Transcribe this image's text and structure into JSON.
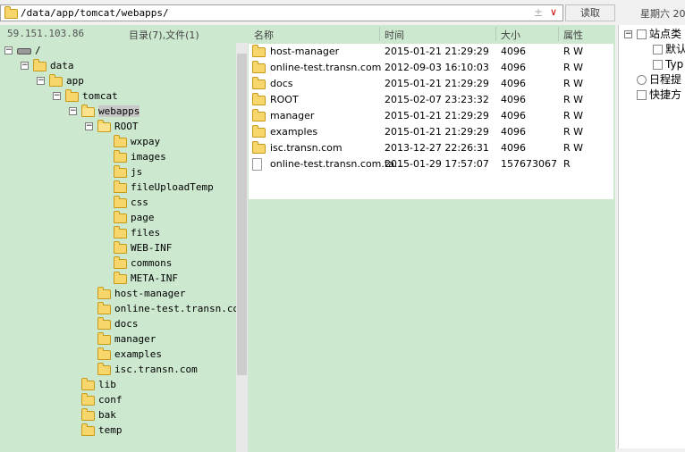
{
  "toolbar": {
    "path": "/data/app/tomcat/webapps/",
    "plus": "±",
    "dropdown": "∨",
    "read_label": "读取",
    "date_text": "星期六 20"
  },
  "left": {
    "ip": "59.151.103.86",
    "counts": "目录(7),文件(1)",
    "tree": [
      {
        "label": "/",
        "level": 0,
        "toggle": "−",
        "icon": "drive"
      },
      {
        "label": "data",
        "level": 1,
        "toggle": "−",
        "icon": "folder"
      },
      {
        "label": "app",
        "level": 2,
        "toggle": "−",
        "icon": "folder"
      },
      {
        "label": "tomcat",
        "level": 3,
        "toggle": "−",
        "icon": "folder"
      },
      {
        "label": "webapps",
        "level": 4,
        "toggle": "−",
        "icon": "folder-open",
        "selected": true
      },
      {
        "label": "ROOT",
        "level": 5,
        "toggle": "−",
        "icon": "folder-open"
      },
      {
        "label": "wxpay",
        "level": 6,
        "icon": "folder"
      },
      {
        "label": "images",
        "level": 6,
        "icon": "folder"
      },
      {
        "label": "js",
        "level": 6,
        "icon": "folder"
      },
      {
        "label": "fileUploadTemp",
        "level": 6,
        "icon": "folder"
      },
      {
        "label": "css",
        "level": 6,
        "icon": "folder"
      },
      {
        "label": "page",
        "level": 6,
        "icon": "folder"
      },
      {
        "label": "files",
        "level": 6,
        "icon": "folder"
      },
      {
        "label": "WEB-INF",
        "level": 6,
        "icon": "folder"
      },
      {
        "label": "commons",
        "level": 6,
        "icon": "folder"
      },
      {
        "label": "META-INF",
        "level": 6,
        "icon": "folder"
      },
      {
        "label": "host-manager",
        "level": 5,
        "icon": "folder"
      },
      {
        "label": "online-test.transn.com",
        "level": 5,
        "icon": "folder"
      },
      {
        "label": "docs",
        "level": 5,
        "icon": "folder"
      },
      {
        "label": "manager",
        "level": 5,
        "icon": "folder"
      },
      {
        "label": "examples",
        "level": 5,
        "icon": "folder"
      },
      {
        "label": "isc.transn.com",
        "level": 5,
        "icon": "folder"
      },
      {
        "label": "lib",
        "level": 4,
        "icon": "folder"
      },
      {
        "label": "conf",
        "level": 4,
        "icon": "folder"
      },
      {
        "label": "bak",
        "level": 4,
        "icon": "folder"
      },
      {
        "label": "temp",
        "level": 4,
        "icon": "folder"
      }
    ]
  },
  "files": {
    "headers": {
      "name": "名称",
      "time": "时间",
      "size": "大小",
      "attr": "属性"
    },
    "rows": [
      {
        "name": "host-manager",
        "time": "2015-01-21 21:29:29",
        "size": "4096",
        "attr": "R W",
        "icon": "folder"
      },
      {
        "name": "online-test.transn.com",
        "time": "2012-09-03 16:10:03",
        "size": "4096",
        "attr": "R W",
        "icon": "folder"
      },
      {
        "name": "docs",
        "time": "2015-01-21 21:29:29",
        "size": "4096",
        "attr": "R W",
        "icon": "folder"
      },
      {
        "name": "ROOT",
        "time": "2015-02-07 23:23:32",
        "size": "4096",
        "attr": "R W",
        "icon": "folder"
      },
      {
        "name": "manager",
        "time": "2015-01-21 21:29:29",
        "size": "4096",
        "attr": "R W",
        "icon": "folder"
      },
      {
        "name": "examples",
        "time": "2015-01-21 21:29:29",
        "size": "4096",
        "attr": "R W",
        "icon": "folder"
      },
      {
        "name": "isc.transn.com",
        "time": "2013-12-27 22:26:31",
        "size": "4096",
        "attr": "R W",
        "icon": "folder"
      },
      {
        "name": "online-test.transn.com.ta...",
        "time": "2015-01-29 17:57:07",
        "size": "157673067",
        "attr": "R",
        "icon": "file"
      }
    ]
  },
  "right": {
    "items": [
      {
        "label": "站点类",
        "toggle": "−",
        "icon": "box"
      },
      {
        "label": "默认",
        "icon": "page"
      },
      {
        "label": "Typ",
        "icon": "page"
      },
      {
        "label": "日程提",
        "icon": "clock"
      },
      {
        "label": "快捷方",
        "icon": "hand"
      }
    ]
  }
}
